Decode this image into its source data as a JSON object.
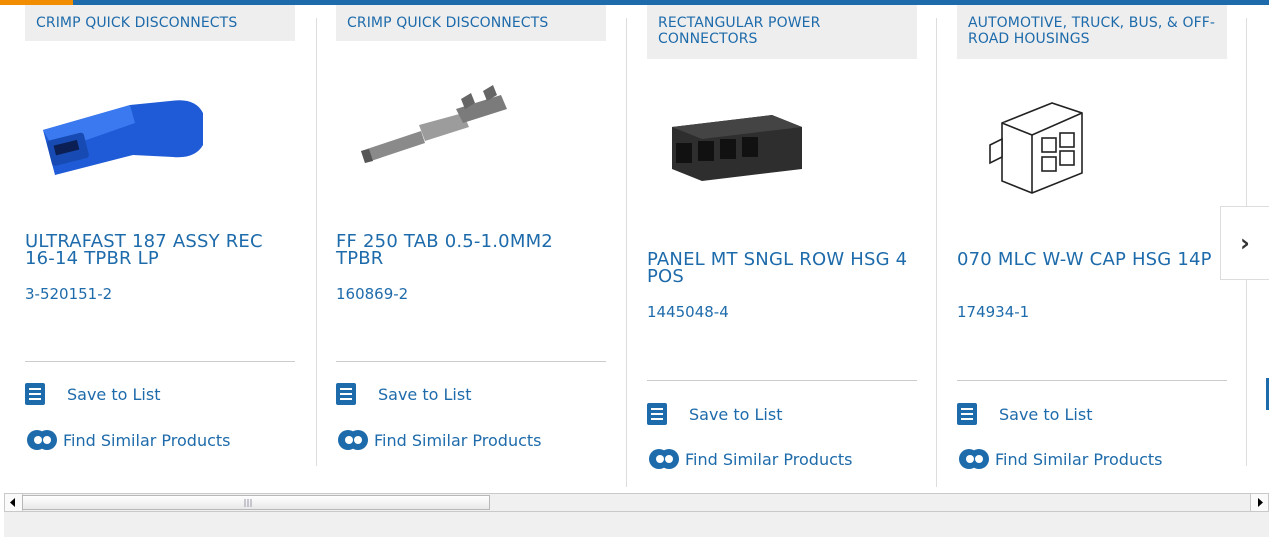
{
  "cards": [
    {
      "category": "CRIMP QUICK DISCONNECTS",
      "title": "ULTRAFAST 187 ASSY REC 16-14 TPBR LP",
      "part": "3-520151-2",
      "save": "Save to List",
      "find": "Find Similar Products",
      "image": "blue-receptacle-terminal"
    },
    {
      "category": "CRIMP QUICK DISCONNECTS",
      "title": "FF 250 TAB 0.5-1.0MM2 TPBR",
      "part": "160869-2",
      "save": "Save to List",
      "find": "Find Similar Products",
      "image": "metal-tab-terminal"
    },
    {
      "category": "RECTANGULAR POWER CONNECTORS",
      "title": "PANEL MT SNGL ROW HSG 4 POS",
      "part": "1445048-4",
      "save": "Save to List",
      "find": "Find Similar Products",
      "image": "black-4-pos-housing"
    },
    {
      "category": "AUTOMOTIVE, TRUCK, BUS, & OFF-ROAD HOUSINGS",
      "title": "070 MLC W-W CAP HSG 14P",
      "part": "174934-1",
      "save": "Save to List",
      "find": "Find Similar Products",
      "image": "white-connector-housing"
    }
  ],
  "next_icon": "chevron-right-icon",
  "next_glyph": "›",
  "colors": {
    "brand": "#1e6bab",
    "accent": "#f28c00",
    "category_bg": "#eeeeee"
  }
}
